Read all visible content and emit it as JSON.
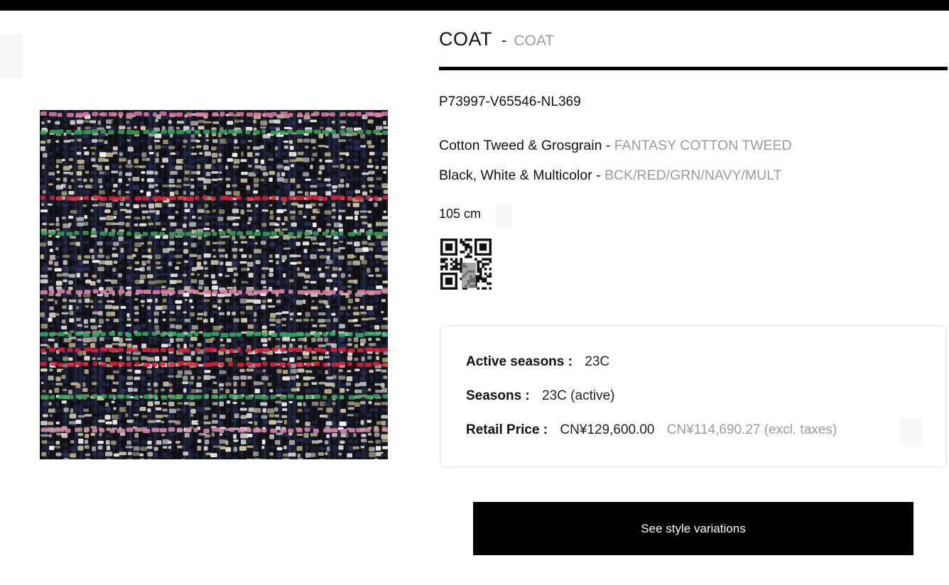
{
  "product": {
    "title": "COAT",
    "separator": "-",
    "subtitle": "COAT",
    "reference": "P73997-V65546-NL369",
    "material_label": "Cotton Tweed & Grosgrain",
    "material_dash": "-",
    "material_code": "FANTASY COTTON TWEED",
    "color_label": "Black, White & Multicolor",
    "color_dash": "-",
    "color_code": "BCK/RED/GRN/NAVY/MULT",
    "size": "105 cm"
  },
  "details": {
    "active_seasons_label": "Active seasons :",
    "active_seasons_value": "23C",
    "seasons_label": "Seasons :",
    "seasons_value": "23C (active)",
    "retail_price_label": "Retail Price :",
    "retail_price_value": "CN¥129,600.00",
    "retail_price_excl": "CN¥114,690.27 (excl. taxes)"
  },
  "actions": {
    "style_variations_label": "See style variations"
  },
  "icons": {
    "qr": "qr-code-icon"
  },
  "colors": {
    "accent": "#000000",
    "muted_text": "#9b9b9b",
    "card_border": "#e4e4e4"
  }
}
